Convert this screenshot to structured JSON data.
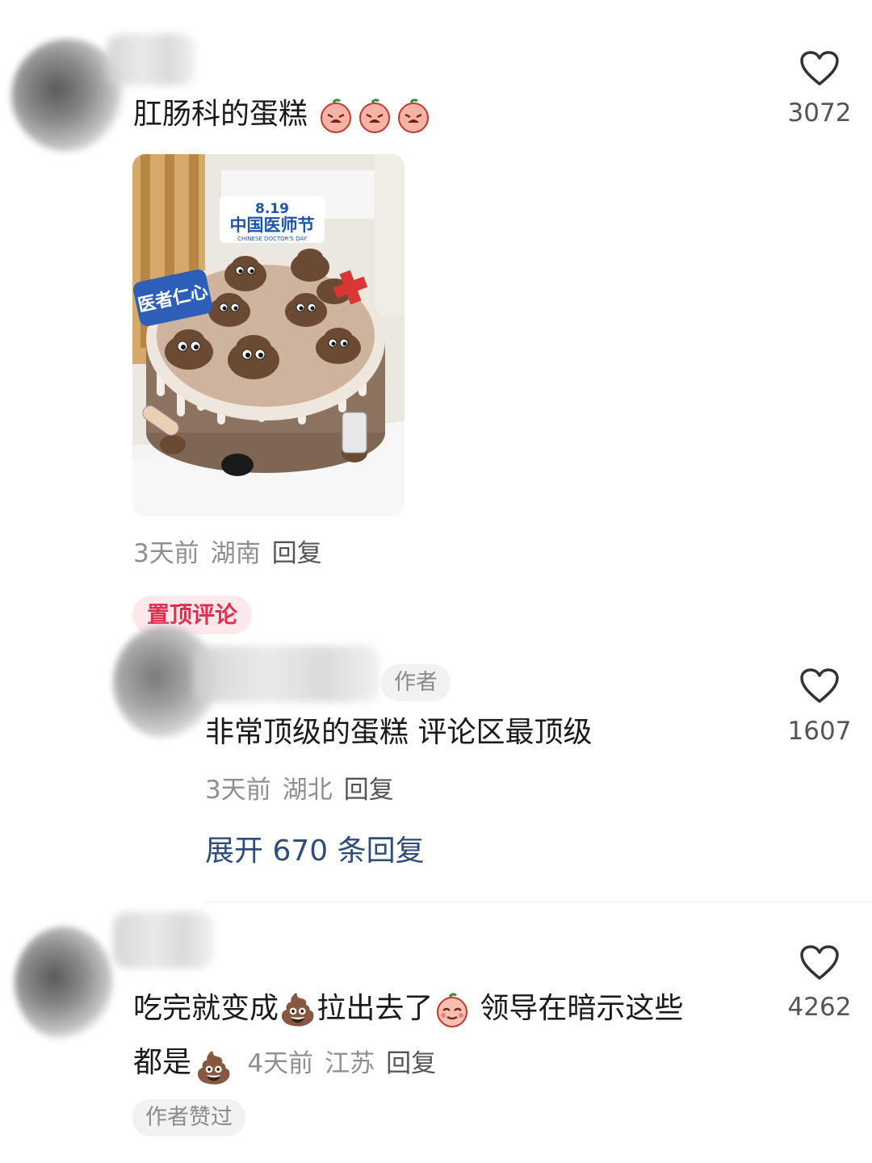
{
  "comments": [
    {
      "text": "肛肠科的蛋糕",
      "emojis": [
        "crying-face-icon",
        "crying-face-icon",
        "crying-face-icon"
      ],
      "time": "3天前",
      "location": "湖南",
      "reply_label": "回复",
      "like_count": "3072",
      "image": {
        "top_banner_date": "8.19",
        "top_banner_title": "中国医师节",
        "top_banner_sub": "CHINESE DOCTOR'S DAY",
        "side_sign": "医者仁心"
      }
    },
    {
      "pinned_label": "置顶评论",
      "author_badge": "作者",
      "text": "非常顶级的蛋糕 评论区最顶级",
      "time": "3天前",
      "location": "湖北",
      "reply_label": "回复",
      "expand_label": "展开 670 条回复",
      "like_count": "1607"
    },
    {
      "text_part1": "吃完就变成",
      "poop_emoji": "💩",
      "text_part2": "拉出去了",
      "text_part3": "领导在暗示这些",
      "text_line2": "都是",
      "time": "4天前",
      "location": "江苏",
      "reply_label": "回复",
      "like_count": "4262",
      "author_liked_label": "作者赞过"
    }
  ]
}
